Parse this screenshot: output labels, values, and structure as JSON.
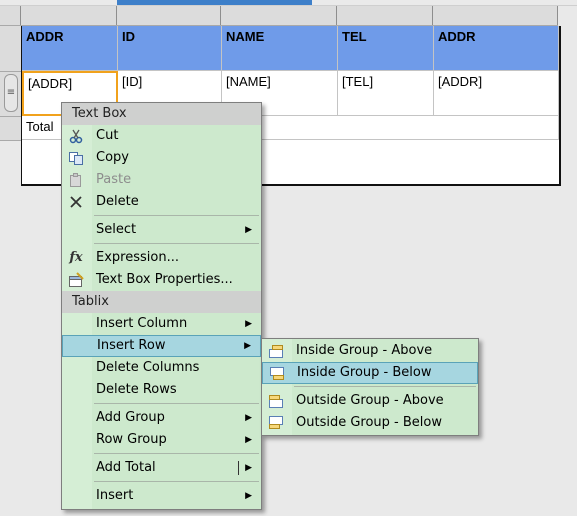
{
  "table": {
    "headers": [
      "ADDR",
      "ID",
      "NAME",
      "TEL",
      "ADDR"
    ],
    "row": [
      "[ADDR]",
      "[ID]",
      "[NAME]",
      "[TEL]",
      "[ADDR]"
    ],
    "total_label": "Total"
  },
  "context_menu": {
    "textbox_header": "Text Box",
    "cut": "Cut",
    "copy": "Copy",
    "paste": "Paste",
    "delete": "Delete",
    "select": "Select",
    "expression": "Expression...",
    "textbox_properties": "Text Box Properties...",
    "tablix_header": "Tablix",
    "insert_column": "Insert Column",
    "insert_row": "Insert Row",
    "delete_columns": "Delete Columns",
    "delete_rows": "Delete Rows",
    "add_group": "Add Group",
    "row_group": "Row Group",
    "add_total": "Add Total",
    "insert": "Insert"
  },
  "submenu": {
    "inside_above": "Inside Group - Above",
    "inside_below": "Inside Group - Below",
    "outside_above": "Outside Group - Above",
    "outside_below": "Outside Group - Below"
  },
  "colors": {
    "header_fill": "#6f9be9",
    "menu_bg": "#cde9cd",
    "highlight": "#a6d6e0",
    "selected_cell_border": "#f1a21c"
  }
}
